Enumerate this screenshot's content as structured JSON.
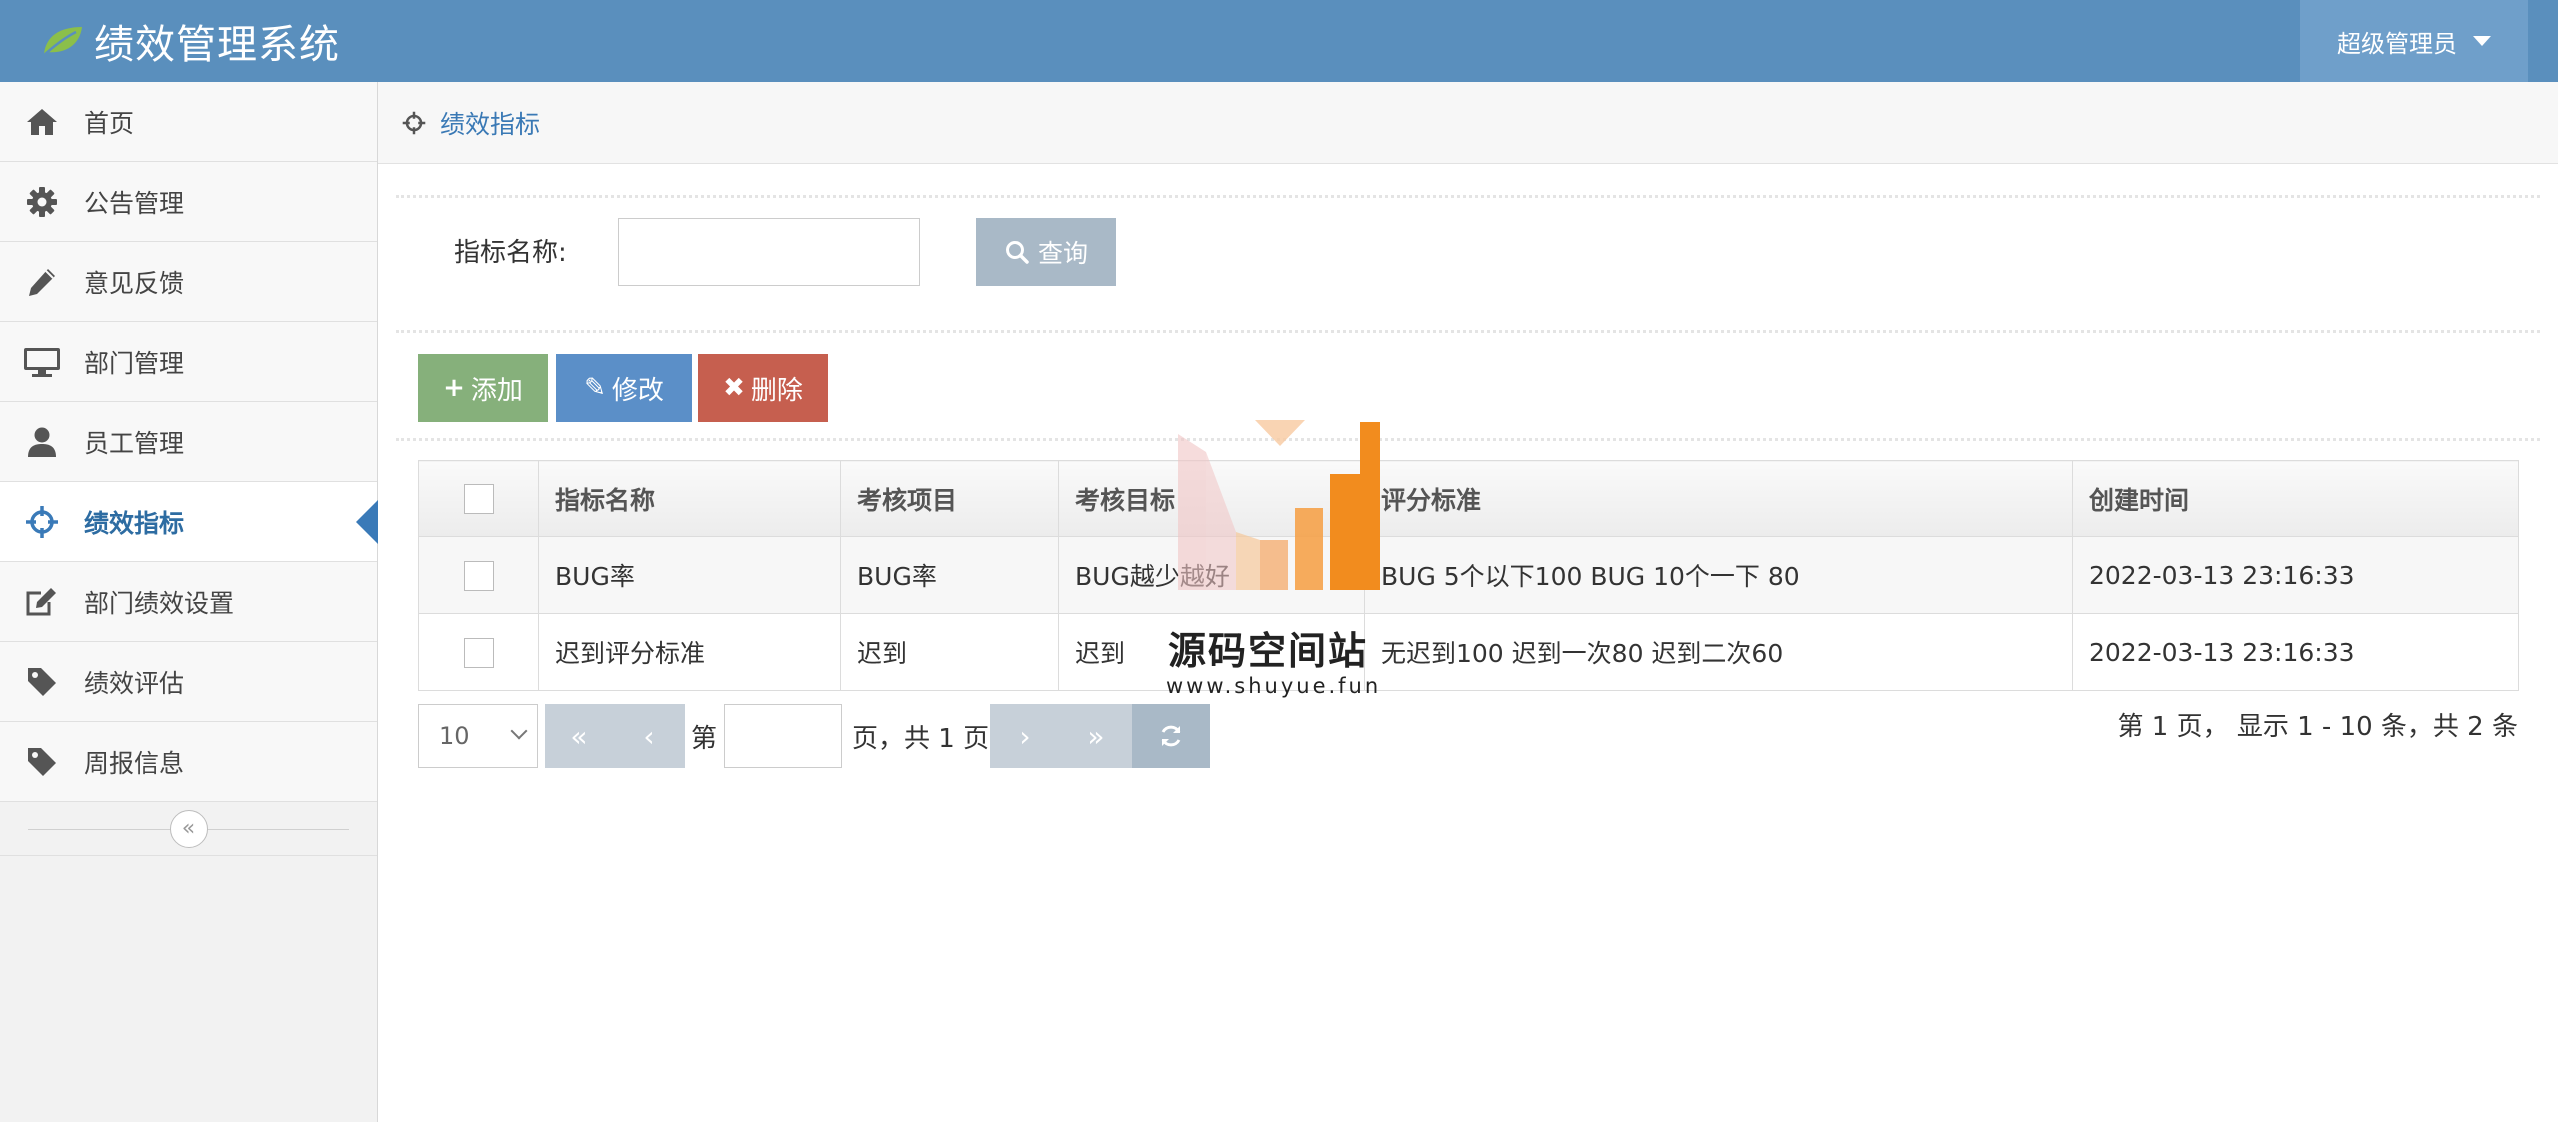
{
  "header": {
    "title": "绩效管理系统",
    "user": "超级管理员",
    "colors": {
      "header_bg": "#5a8fbd",
      "user_bg": "#6f9fca",
      "leaf": "#8bbf4a"
    }
  },
  "sidebar": {
    "items": [
      {
        "label": "首页",
        "icon": "home-icon"
      },
      {
        "label": "公告管理",
        "icon": "gear-icon"
      },
      {
        "label": "意见反馈",
        "icon": "pencil-icon"
      },
      {
        "label": "部门管理",
        "icon": "monitor-icon"
      },
      {
        "label": "员工管理",
        "icon": "user-icon"
      },
      {
        "label": "绩效指标",
        "icon": "crosshairs-icon",
        "active": true
      },
      {
        "label": "部门绩效设置",
        "icon": "edit-icon"
      },
      {
        "label": "绩效评估",
        "icon": "tag-icon"
      },
      {
        "label": "周报信息",
        "icon": "tag-icon"
      }
    ],
    "collapse_glyph": "«"
  },
  "breadcrumb": {
    "label": "绩效指标",
    "icon": "crosshairs-icon"
  },
  "search": {
    "label": "指标名称:",
    "value": "",
    "button": "查询"
  },
  "toolbar": {
    "add": {
      "glyph": "+",
      "label": "添加"
    },
    "edit": {
      "glyph": "✎",
      "label": "修改"
    },
    "delete": {
      "glyph": "✖",
      "label": "删除"
    },
    "colors": {
      "add": "#86b07b",
      "edit": "#5b8fc8",
      "delete": "#c65f4f"
    }
  },
  "table": {
    "headers": [
      "指标名称",
      "考核项目",
      "考核目标",
      "评分标准",
      "创建时间"
    ],
    "rows": [
      [
        "BUG率",
        "BUG率",
        "BUG越少越好",
        "BUG 5个以下100 BUG 10个一下 80",
        "2022-03-13 23:16:33"
      ],
      [
        "迟到评分标准",
        "迟到",
        "迟到",
        "无迟到100 迟到一次80 迟到二次60",
        "2022-03-13 23:16:33"
      ]
    ]
  },
  "pager": {
    "page_size": "10",
    "first": "«",
    "prev": "‹",
    "page_prefix": "第",
    "page_value": "",
    "page_suffix": "页，共 1 页",
    "next": "›",
    "last": "»",
    "refresh_icon": "refresh-icon",
    "info": "第 1 页， 显示 1 - 10 条，共 2 条"
  },
  "watermark": {
    "text": "源码空间站",
    "url": "www.shuyue.fun"
  }
}
